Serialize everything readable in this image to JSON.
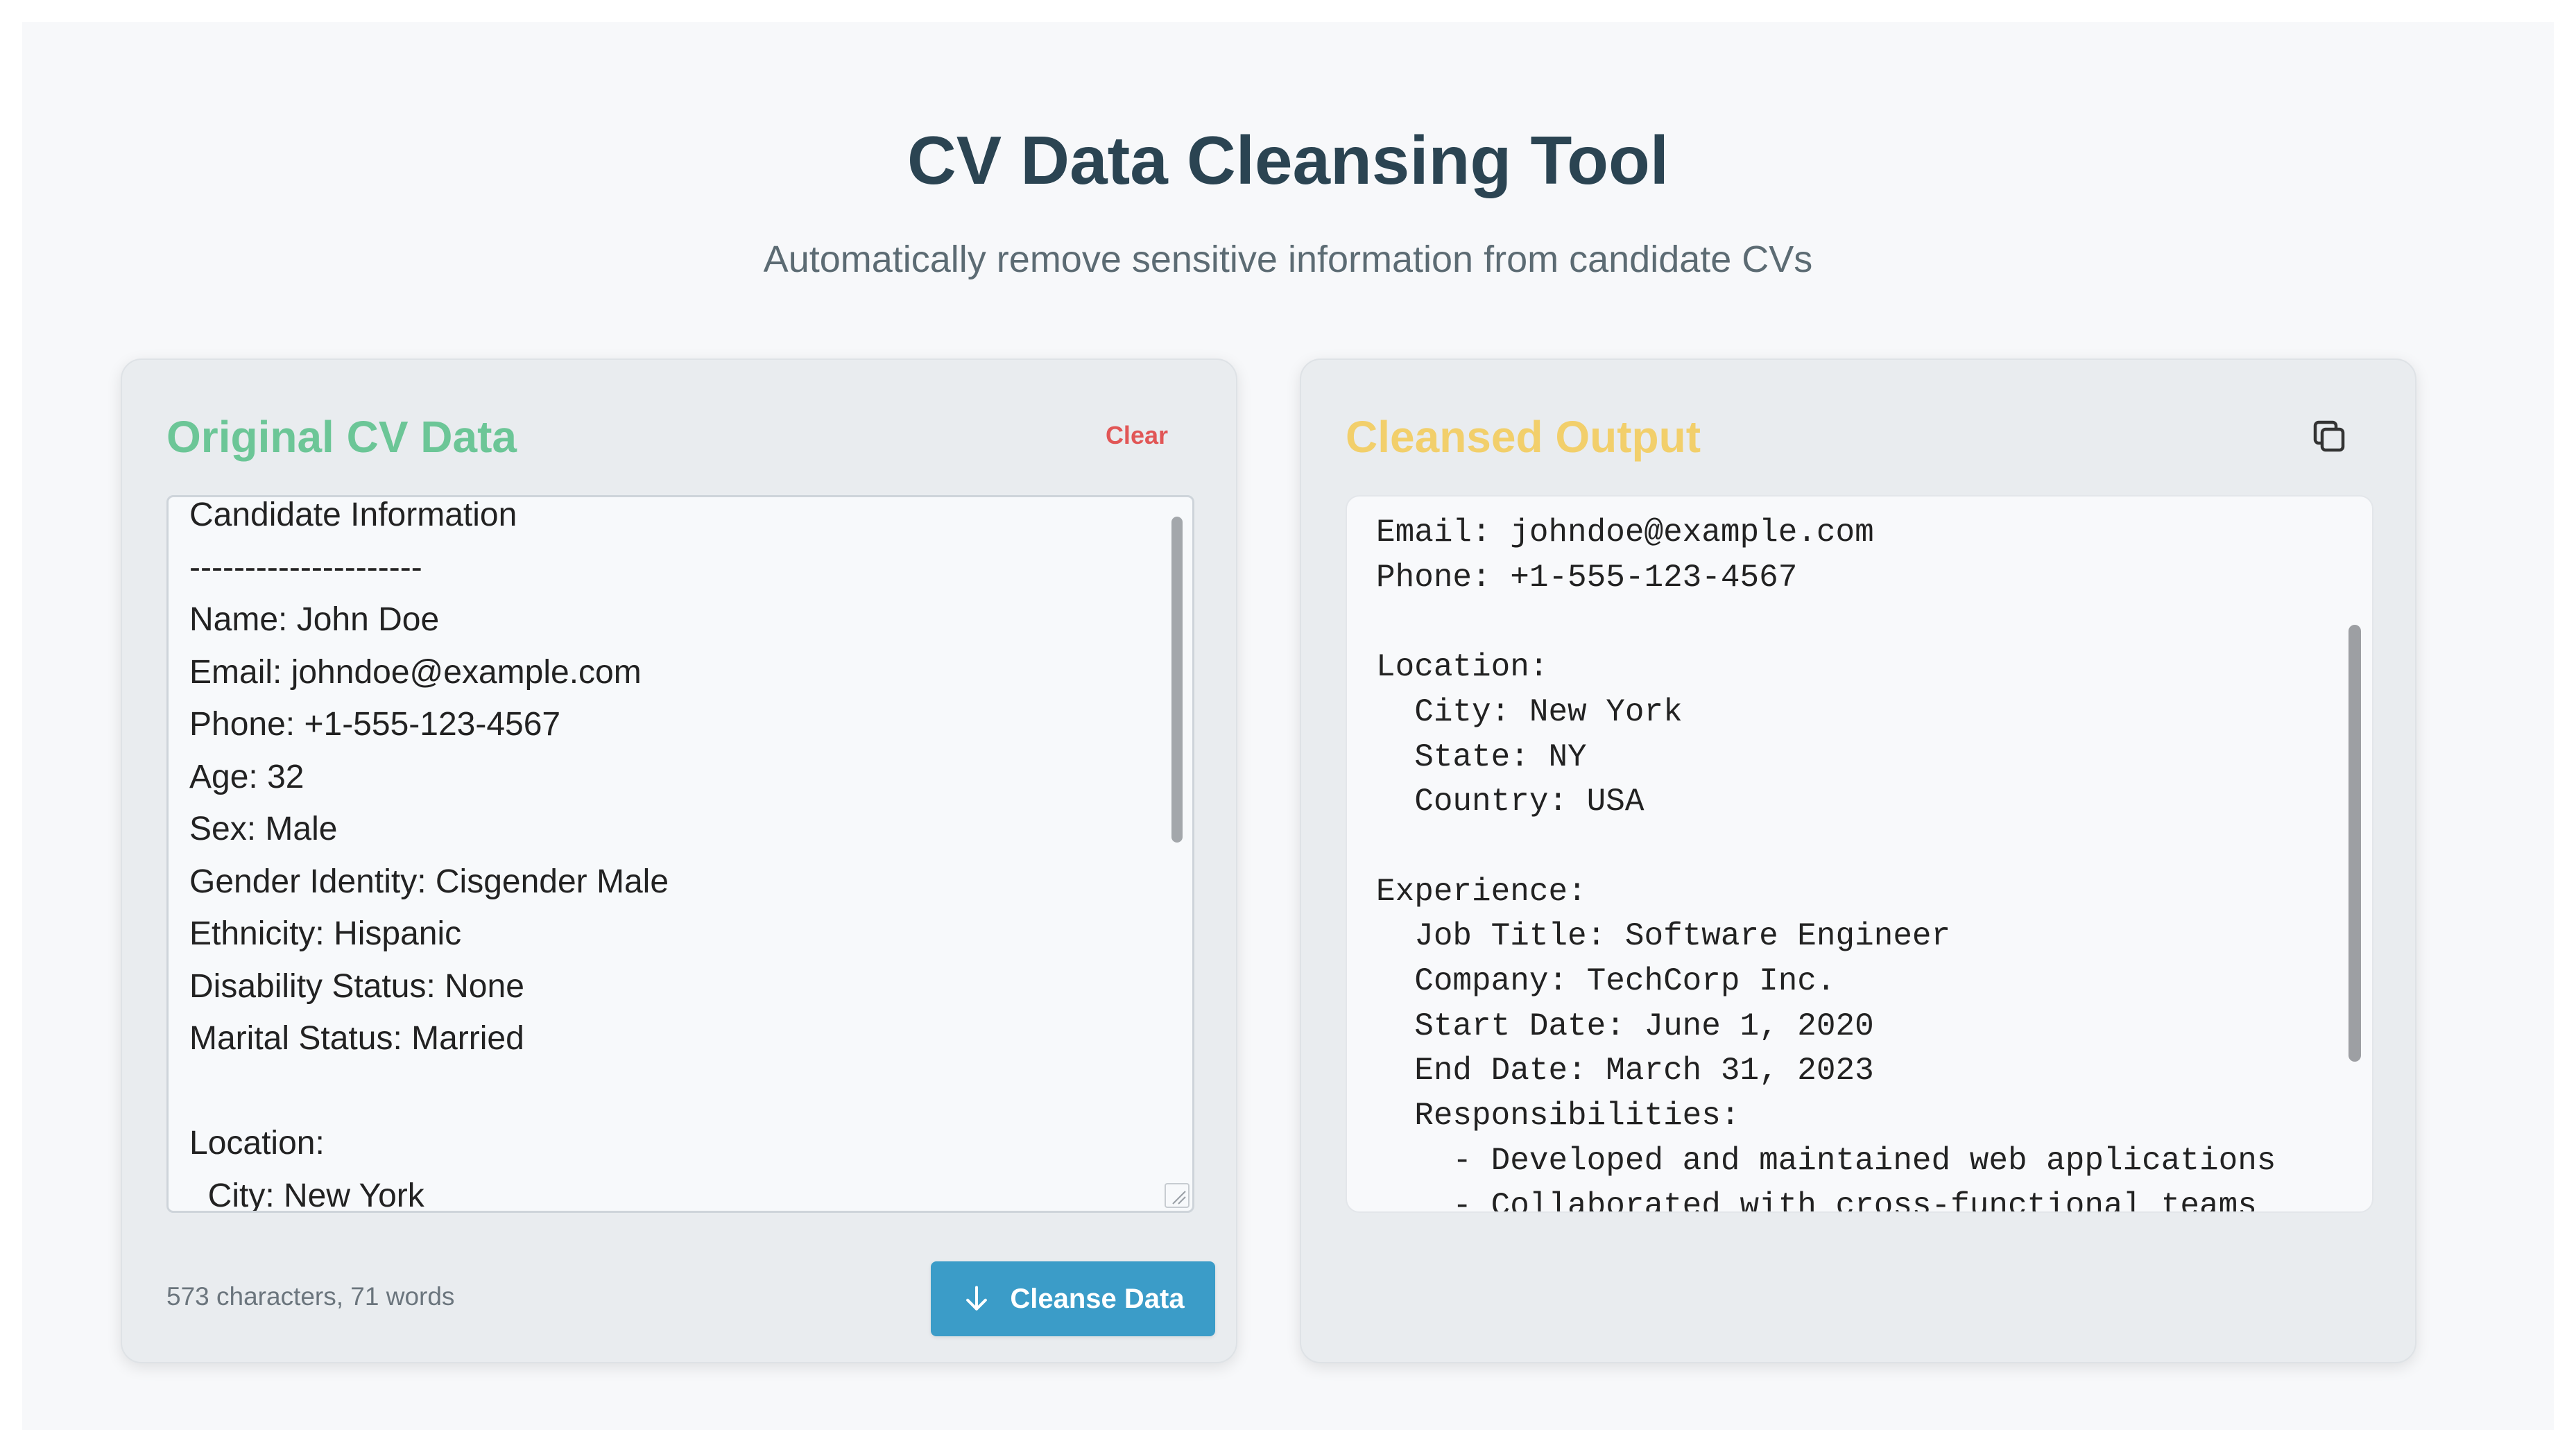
{
  "header": {
    "title": "CV Data Cleansing Tool",
    "subtitle": "Automatically remove sensitive information from candidate CVs"
  },
  "input_panel": {
    "title": "Original CV Data",
    "clear_label": "Clear",
    "text": "Candidate Information\n---------------------\nName: John Doe\nEmail: johndoe@example.com\nPhone: +1-555-123-4567\nAge: 32\nSex: Male\nGender Identity: Cisgender Male\nEthnicity: Hispanic\nDisability Status: None\nMarital Status: Married\n\nLocation:\n  City: New York",
    "stats": "573 characters, 71 words",
    "cleanse_label": "Cleanse Data",
    "cleanse_icon": "arrow-down-icon"
  },
  "output_panel": {
    "title": "Cleansed Output",
    "copy_icon": "copy-icon",
    "text": "Email: johndoe@example.com\nPhone: +1-555-123-4567\n\nLocation:\n  City: New York\n  State: NY\n  Country: USA\n\nExperience:\n  Job Title: Software Engineer\n  Company: TechCorp Inc.\n  Start Date: June 1, 2020\n  End Date: March 31, 2023\n  Responsibilities:\n    - Developed and maintained web applications\n    - Collaborated with cross-functional teams"
  },
  "colors": {
    "title": "#2b4452",
    "input_title": "#6cc697",
    "output_title": "#f2cf6b",
    "clear": "#e15656",
    "primary_button": "#3b9cc8"
  }
}
